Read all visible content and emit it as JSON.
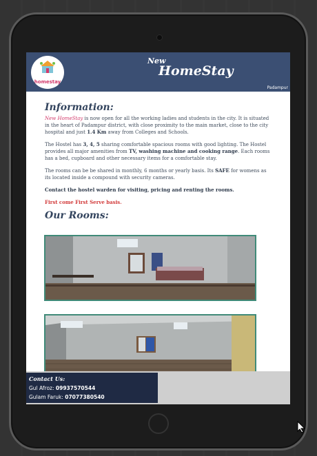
{
  "header": {
    "logo_text": "homestay",
    "title_prefix": "New",
    "title": "HomeStay",
    "location": "Padampur"
  },
  "info": {
    "heading": "Information:",
    "p1_brand": "New HomeStay",
    "p1_a": " is now open for all the working ladies and students in the city. It is situated in the heart of Padampur district, with close proximity to the main market, close to the city hospital and just ",
    "p1_dist": "1.4 Km",
    "p1_b": " away from Colleges and Schools.",
    "p2_a": "The Hostel has ",
    "p2_sharing": "3, 4, 5",
    "p2_b": " sharing comfortable spacious rooms with good lighting. The Hostel provides all major amenities from ",
    "p2_amen": "TV, washing machine and cooking range",
    "p2_c": ". Each rooms has a bed, cupboard and other necessary items for a comfortable stay.",
    "p3_a": "The rooms can be be shared in monthly, 6 months or yearly basis. Its ",
    "p3_safe": "SAFE",
    "p3_b": " for womens as its located inside a compound with security cameras.",
    "contact_note": "Contact the hostel warden for visiting, pricing and renting the rooms.",
    "first_come": "First come First Serve basis."
  },
  "rooms": {
    "heading": "Our Rooms:"
  },
  "contact": {
    "title": "Contact Us:",
    "person1_name": "Gul Afroz: ",
    "person1_phone": "09937570544",
    "person2_name": "Gulam Faruk: ",
    "person2_phone": "07077380540"
  },
  "colors": {
    "header_bg": "#3b4f73",
    "accent_pink": "#d23a6b",
    "image_border": "#3f8a78",
    "contact_bg": "#1f2a44"
  }
}
